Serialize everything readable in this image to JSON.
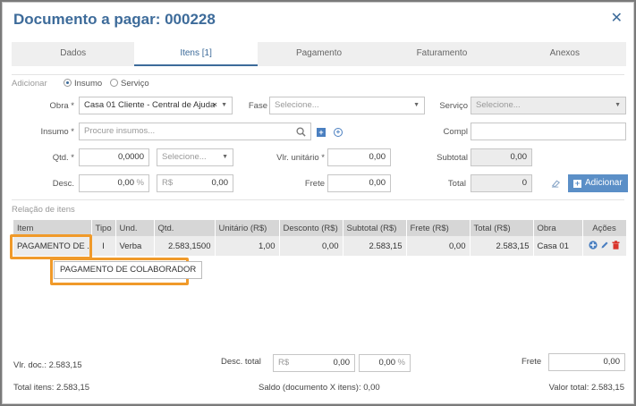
{
  "header": {
    "title": "Documento a pagar: 000228",
    "close_symbol": "✕"
  },
  "tabs": [
    "Dados",
    "Itens [1]",
    "Pagamento",
    "Faturamento",
    "Anexos"
  ],
  "add_section": {
    "label": "Adicionar",
    "type_options": {
      "insumo": "Insumo",
      "servico": "Serviço",
      "selected": "Insumo"
    },
    "obra": {
      "label": "Obra *",
      "value": "Casa 01 Cliente - Central de Ajuda"
    },
    "fase": {
      "label": "Fase",
      "placeholder": "Selecione..."
    },
    "servico": {
      "label": "Serviço",
      "placeholder": "Selecione..."
    },
    "insumo": {
      "label": "Insumo *",
      "placeholder": "Procure insumos..."
    },
    "compl": {
      "label": "Compl",
      "value": ""
    },
    "qtd": {
      "label": "Qtd. *",
      "value": "0,0000",
      "unit_placeholder": "Selecione..."
    },
    "vlr_unitario": {
      "label": "Vlr. unitário *",
      "value": "0,00"
    },
    "subtotal": {
      "label": "Subtotal",
      "value": "0,00"
    },
    "desc": {
      "label": "Desc.",
      "value": "0,00",
      "pct_symbol": "%",
      "currency_prefix": "R$",
      "currency_value": "0,00"
    },
    "frete": {
      "label": "Frete",
      "value": "0,00"
    },
    "total": {
      "label": "Total",
      "value": "0"
    },
    "add_button": "Adicionar",
    "plus_symbol": "+"
  },
  "items_section": {
    "label": "Relação de itens",
    "columns": [
      "Item",
      "Tipo",
      "Und.",
      "Qtd.",
      "Unitário (R$)",
      "Desconto (R$)",
      "Subtotal (R$)",
      "Frete (R$)",
      "Total (R$)",
      "Obra",
      "Ações"
    ],
    "rows": [
      {
        "item": "PAGAMENTO DE ...",
        "tipo": "I",
        "und": "Verba",
        "qtd": "2.583,1500",
        "unitario": "1,00",
        "desconto": "0,00",
        "subtotal": "2.583,15",
        "frete": "0,00",
        "total": "2.583,15",
        "obra": "Casa 01"
      }
    ],
    "tooltip": "PAGAMENTO DE COLABORADOR"
  },
  "footer": {
    "vlr_doc": "Vlr. doc.: 2.583,15",
    "desc_total_label": "Desc. total",
    "desc_total_prefix": "R$",
    "desc_total_value": "0,00",
    "desc_total_pct": "0,00",
    "pct_symbol": "%",
    "frete_label": "Frete",
    "frete_value": "0,00",
    "total_itens": "Total itens: 2.583,15",
    "saldo": "Saldo (documento X itens): 0,00",
    "valor_total": "Valor total: 2.583,15"
  },
  "colors": {
    "accent": "#3d6b9a",
    "button": "#5b8fc7",
    "highlight": "#f09a2a",
    "delete": "#d9342b"
  }
}
